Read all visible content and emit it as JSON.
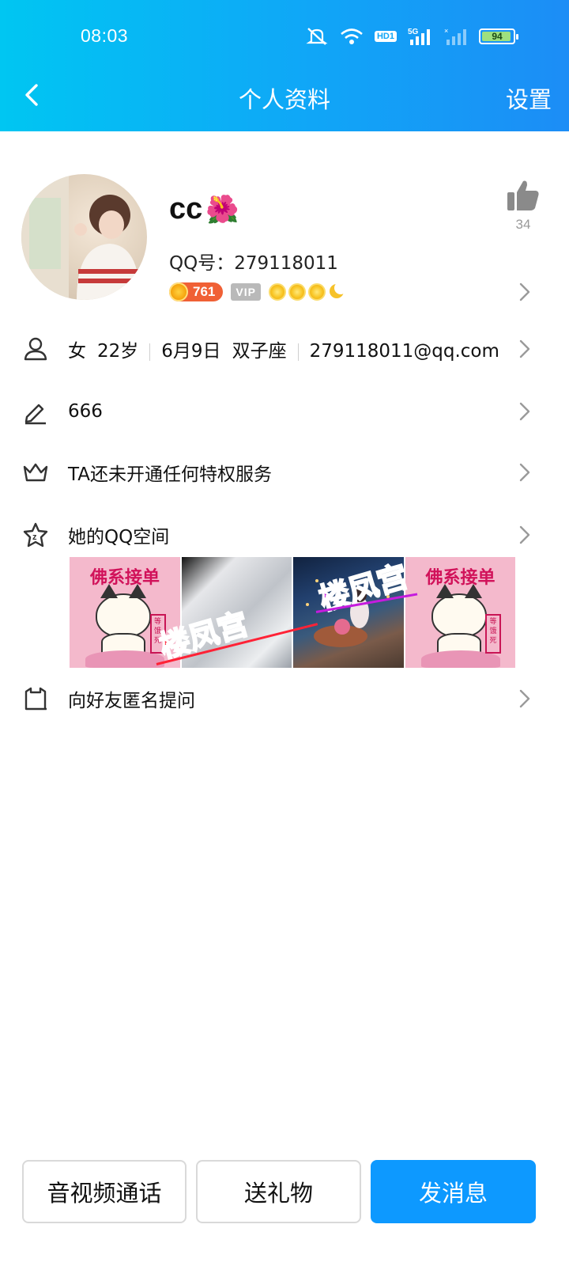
{
  "status_bar": {
    "time": "08:03",
    "network": "5G",
    "hd": "HD1",
    "battery": "94",
    "battery_level": 0.94
  },
  "nav": {
    "title": "个人资料",
    "settings_label": "设置",
    "back_icon": "chevron-left-icon"
  },
  "profile": {
    "nickname": "cc",
    "nickname_emoji": "🌺",
    "qq_label": "QQ号：",
    "qq_number": "279118011",
    "level": "761",
    "vip_label": "VIP",
    "like_count": "34",
    "like_icon": "thumbs-up-icon"
  },
  "info": {
    "gender": "女",
    "age": "22岁",
    "birthday": "6月9日",
    "zodiac": "双子座",
    "email": "279118011@qq.com"
  },
  "rows": {
    "signature": "666",
    "privilege": "TA还未开通任何特权服务",
    "qzone": "她的QQ空间",
    "anonymous_question": "向好友匿名提问"
  },
  "photos": {
    "cat_title": "佛系接单",
    "stamp_text": "等饿死",
    "watermark": "楼凤宫"
  },
  "buttons": {
    "call": "音视频通话",
    "gift": "送礼物",
    "message": "发消息"
  },
  "colors": {
    "header_start": "#00c6f2",
    "header_end": "#1c8df6",
    "primary_button": "#0d99ff",
    "level_badge": "#f06035"
  }
}
